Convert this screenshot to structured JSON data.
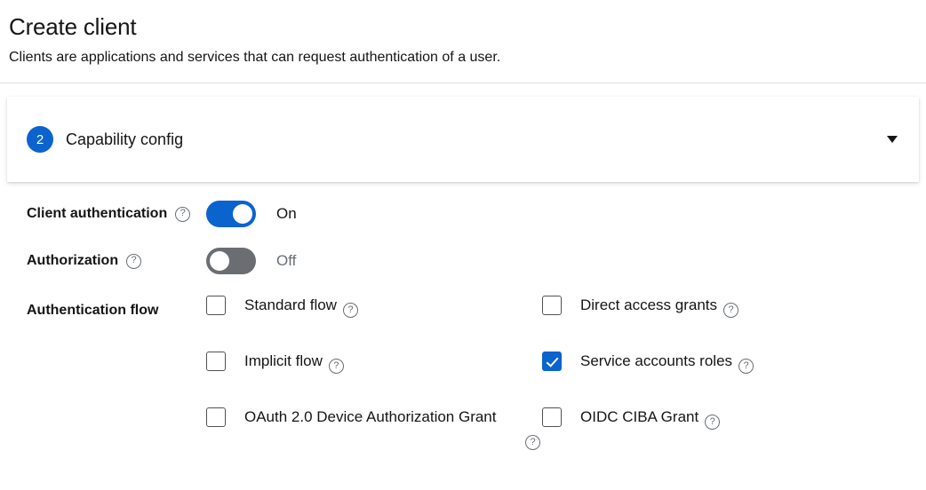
{
  "header": {
    "title": "Create client",
    "subtitle": "Clients are applications and services that can request authentication of a user."
  },
  "section": {
    "step_number": "2",
    "label": "Capability config",
    "caret_icon": "chevron-down-icon",
    "expanded": true
  },
  "help_icon_glyph": "?",
  "form": {
    "client_authentication": {
      "label": "Client authentication",
      "state_text": "On",
      "enabled": true,
      "help_icon": "help-circle-icon"
    },
    "authorization": {
      "label": "Authorization",
      "state_text": "Off",
      "enabled": false,
      "help_icon": "help-circle-icon"
    },
    "authentication_flow": {
      "label": "Authentication flow",
      "options": [
        {
          "label": "Standard flow",
          "checked": false,
          "help_icon": "help-circle-icon"
        },
        {
          "label": "Direct access grants",
          "checked": false,
          "help_icon": "help-circle-icon"
        },
        {
          "label": "Implicit flow",
          "checked": false,
          "help_icon": "help-circle-icon"
        },
        {
          "label": "Service accounts roles",
          "checked": true,
          "help_icon": "help-circle-icon"
        },
        {
          "label": "OAuth 2.0 Device Authorization Grant",
          "checked": false,
          "help_icon": "help-circle-icon"
        },
        {
          "label": "OIDC CIBA Grant",
          "checked": false,
          "help_icon": "help-circle-icon"
        }
      ]
    }
  },
  "colors": {
    "accent_blue": "#0b63ce",
    "toggle_off_gray": "#6a6e73",
    "text_primary": "#151515",
    "divider": "#e0e0e0"
  }
}
